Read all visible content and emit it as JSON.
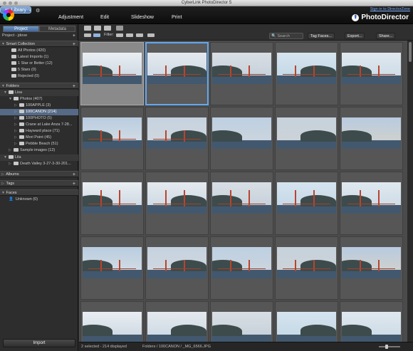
{
  "window": {
    "title": "CyberLink PhotoDirector 5"
  },
  "modules": {
    "library": "Library",
    "adjustment": "Adjustment",
    "edit": "Edit",
    "slideshow": "Slideshow",
    "print": "Print"
  },
  "account": {
    "sign_in": "Sign in to DirectorZone"
  },
  "brand": {
    "name": "PhotoDirector"
  },
  "panel": {
    "tabs": {
      "project": "Project",
      "metadata": "Metadata"
    },
    "project_label": "Project - jdove",
    "smart_collection": {
      "title": "Smart Collection",
      "items": [
        "All Photos (420)",
        "Latest Imports (1)",
        "1 Star or Better (12)",
        "5 Stars (0)",
        "Rejected (0)"
      ]
    },
    "folders": {
      "title": "Folders",
      "root": "Lisa",
      "photos": "Photos (407)",
      "items": [
        "100APPLE (3)",
        "100CANON (214)",
        "100PHOTO (5)",
        "Crane at Lake Anza 7-28...",
        "Hayward place (71)",
        "Mori Point (45)",
        "Pebble Beach (51)"
      ],
      "sample": "Sample images (12)",
      "root2": "Lila",
      "death_valley": "Death Valley 3-27-3-30-201..."
    },
    "albums": "Albums",
    "tags": "Tags",
    "faces": "Faces",
    "unknown": "Unknown (0)",
    "import": "Import"
  },
  "toolbar": {
    "filter": "Filter:",
    "search_placeholder": "Search",
    "tag_faces": "Tag Faces...",
    "export": "Export...",
    "share": "Share..."
  },
  "status": {
    "selection": "2 selected - 214 displayed",
    "path": "Folders / 100CANON / _MG_6566.JPG"
  }
}
